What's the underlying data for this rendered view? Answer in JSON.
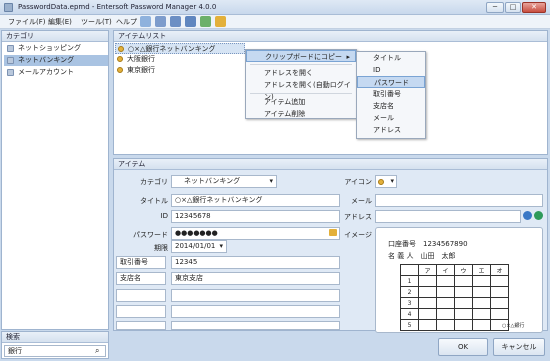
{
  "window": {
    "title": "PasswordData.epmd - Entersoft Password Manager 4.0.0",
    "min": "─",
    "max": "□",
    "close": "✕"
  },
  "menu": [
    "ファイル(F)",
    "編集(E)",
    "ツール(T)",
    "ヘルプ"
  ],
  "categories": {
    "header": "カテゴリ",
    "items": [
      "ネットショッピング",
      "ネットバンキング",
      "メールアカウント"
    ]
  },
  "search": {
    "header": "検索",
    "value": "銀行"
  },
  "items": {
    "header": "アイテムリスト",
    "rows": [
      "○×△銀行ネットバンキング",
      "大阪銀行",
      "東京銀行"
    ]
  },
  "context_menu": [
    "クリップボードにコピー",
    "アドレスを開く",
    "アドレスを開く(自動ログイン)",
    "アイテム追加",
    "アイテム削除"
  ],
  "submenu": [
    "タイトル",
    "ID",
    "パスワード",
    "取引番号",
    "支店名",
    "メール",
    "アドレス"
  ],
  "detail": {
    "header": "アイテム",
    "category_label": "カテゴリ",
    "category_value": "ネットバンキング",
    "title_label": "タイトル",
    "title_value": "○×△銀行ネットバンキング",
    "id_label": "ID",
    "id_value": "12345678",
    "password_label": "パスワード",
    "password_value": "●●●●●●●",
    "expiry_label": "期限",
    "expiry_value": "2014/01/01",
    "extra": [
      {
        "label": "取引番号",
        "value": "12345"
      },
      {
        "label": "支店名",
        "value": "東京支店"
      }
    ],
    "icon_label": "アイコン",
    "mail_label": "メール",
    "address_label": "アドレス",
    "image_label": "イメージ"
  },
  "card": {
    "account_label": "口座番号",
    "account_value": "1234567890",
    "name_label": "名 義 人",
    "name_value": "山田　太郎",
    "columns": [
      "ア",
      "イ",
      "ウ",
      "エ",
      "オ"
    ],
    "rows": [
      "1",
      "2",
      "3",
      "4",
      "5"
    ],
    "footer": "○×△銀行"
  },
  "buttons": {
    "ok": "OK",
    "cancel": "キャンセル"
  }
}
